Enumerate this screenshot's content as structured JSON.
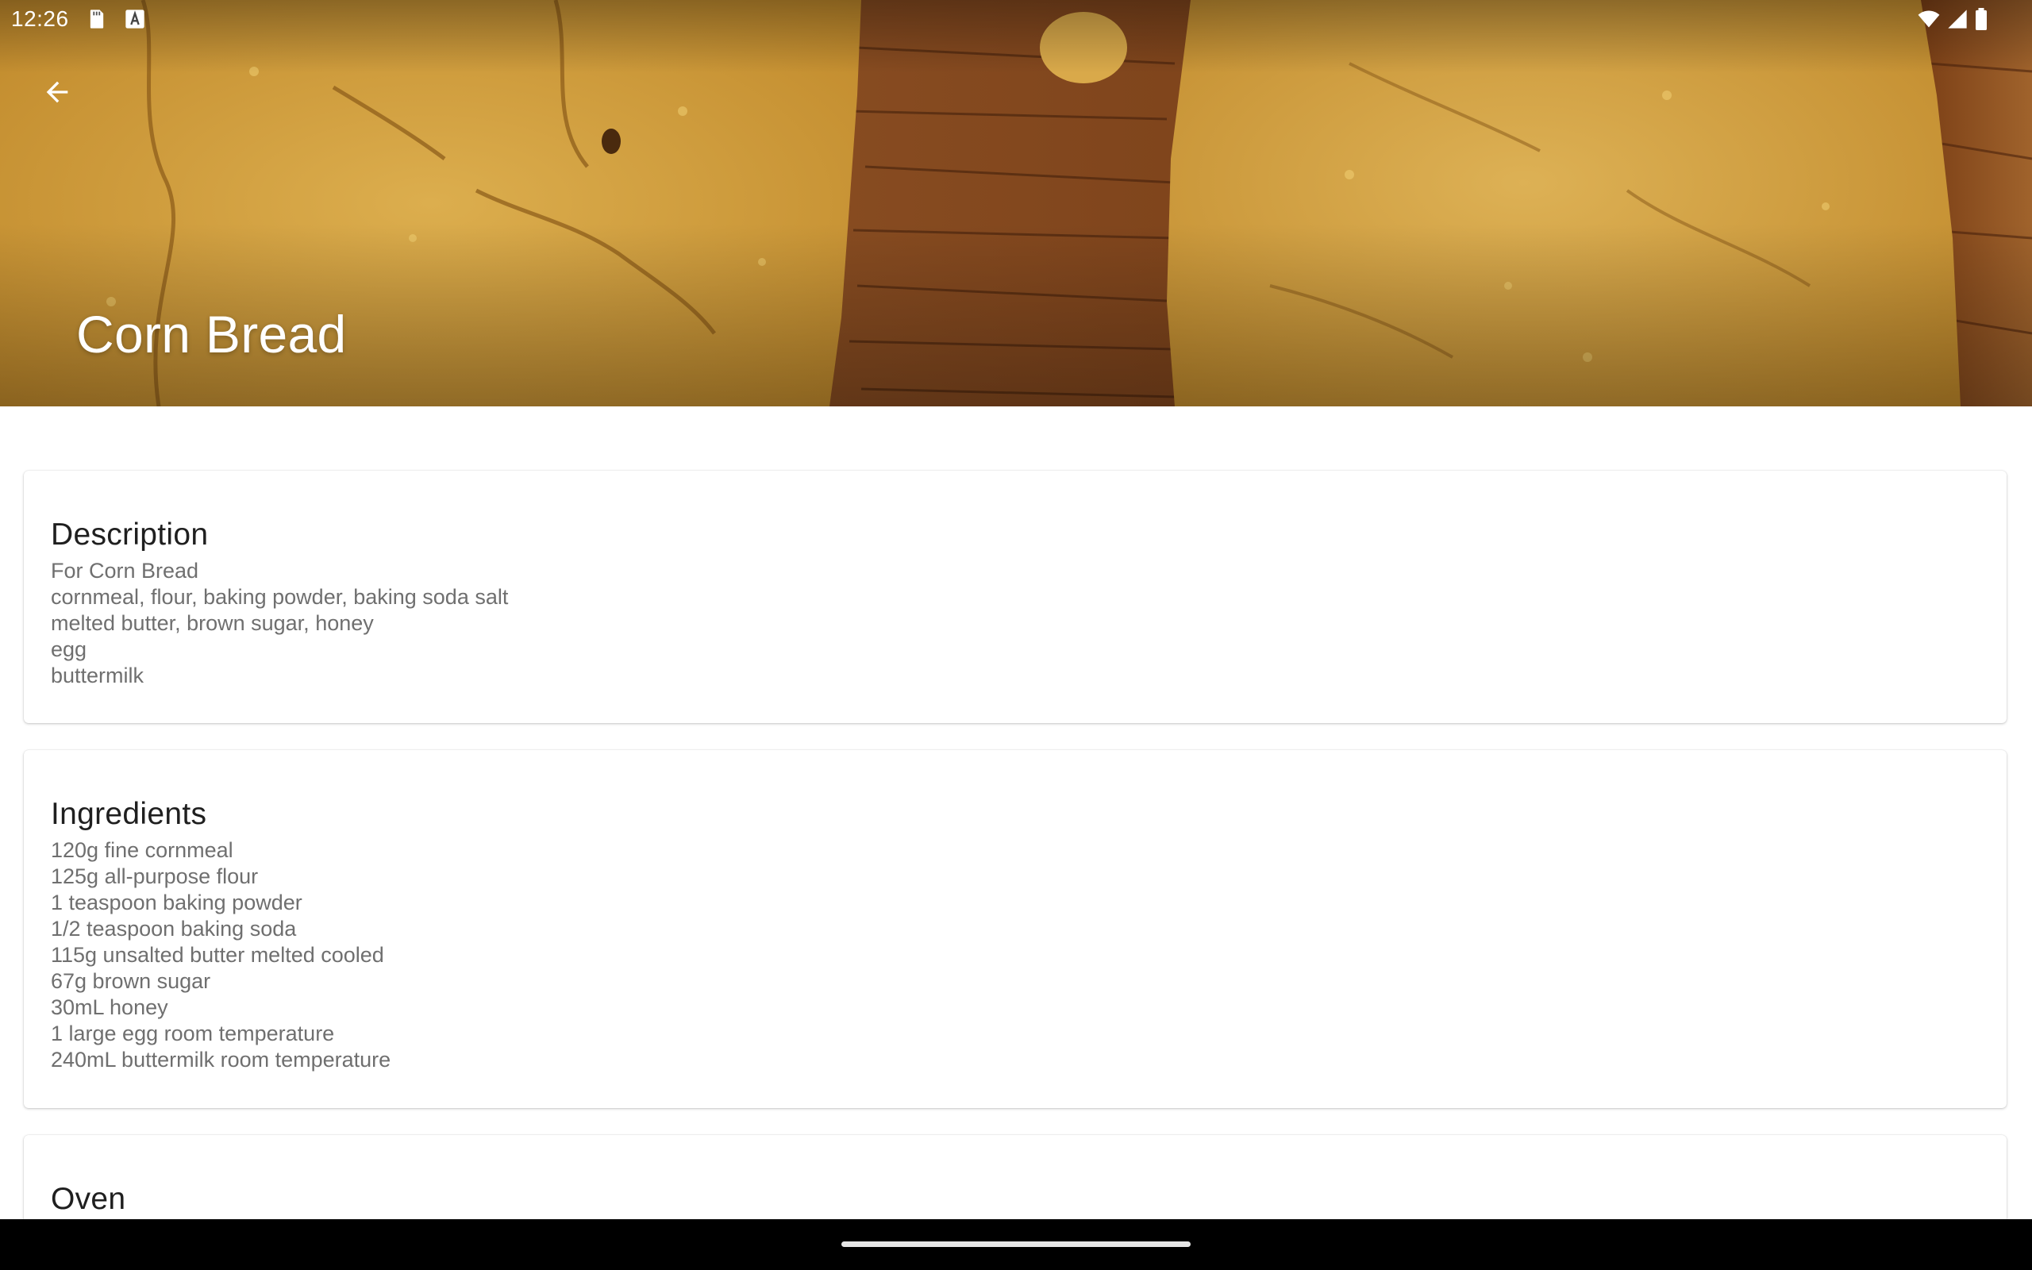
{
  "status_bar": {
    "time": "12:26",
    "left_icons": [
      "sd-card-icon",
      "app-notification-icon"
    ],
    "right_icons": [
      "wifi-icon",
      "cell-signal-icon",
      "battery-icon"
    ]
  },
  "app_bar": {
    "back_icon": "arrow-back-icon",
    "title": "Corn Bread"
  },
  "cards": {
    "description": {
      "title": "Description",
      "lines": [
        "For Corn Bread",
        "cornmeal, flour, baking powder, baking soda salt",
        "melted butter, brown sugar, honey",
        "egg",
        "buttermilk"
      ]
    },
    "ingredients": {
      "title": "Ingredients",
      "lines": [
        "120g fine cornmeal",
        "125g all-purpose flour",
        "1 teaspoon baking powder",
        "1/2 teaspoon baking soda",
        "115g unsalted butter melted cooled",
        "67g brown sugar",
        "30mL honey",
        "1 large egg room temperature",
        "240mL buttermilk room temperature"
      ]
    },
    "oven": {
      "title": "Oven"
    }
  },
  "colors": {
    "title_text": "#ffffff",
    "card_title": "#1f1f1f",
    "card_body": "#6f6f6f",
    "nav_bar": "#000000"
  }
}
